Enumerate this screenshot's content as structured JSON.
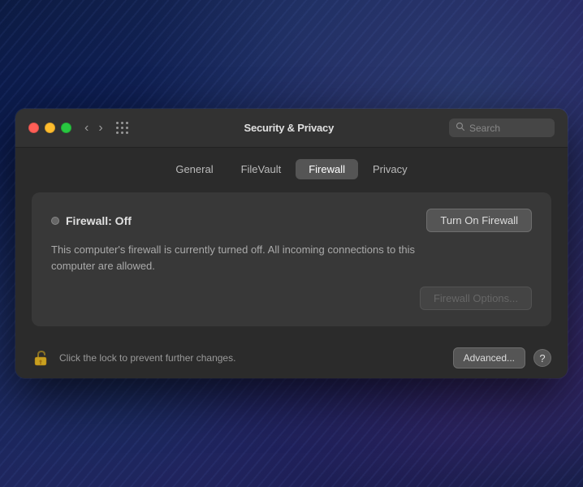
{
  "wallpaper": {},
  "window": {
    "title": "Security & Privacy",
    "traffic_lights": {
      "close_label": "close",
      "minimize_label": "minimize",
      "zoom_label": "zoom"
    },
    "nav": {
      "back_label": "‹",
      "forward_label": "›"
    },
    "search": {
      "placeholder": "Search"
    }
  },
  "tabs": [
    {
      "id": "general",
      "label": "General",
      "active": false
    },
    {
      "id": "filevault",
      "label": "FileVault",
      "active": false
    },
    {
      "id": "firewall",
      "label": "Firewall",
      "active": true
    },
    {
      "id": "privacy",
      "label": "Privacy",
      "active": false
    }
  ],
  "firewall": {
    "status_label": "Firewall: Off",
    "turn_on_button": "Turn On Firewall",
    "description": "This computer's firewall is currently turned off. All incoming connections to this computer are allowed.",
    "options_button": "Firewall Options..."
  },
  "bottom_bar": {
    "lock_tooltip": "Click the lock to prevent further changes.",
    "help_text": "Click the lock to prevent further changes.",
    "advanced_button": "Advanced...",
    "help_button": "?"
  }
}
